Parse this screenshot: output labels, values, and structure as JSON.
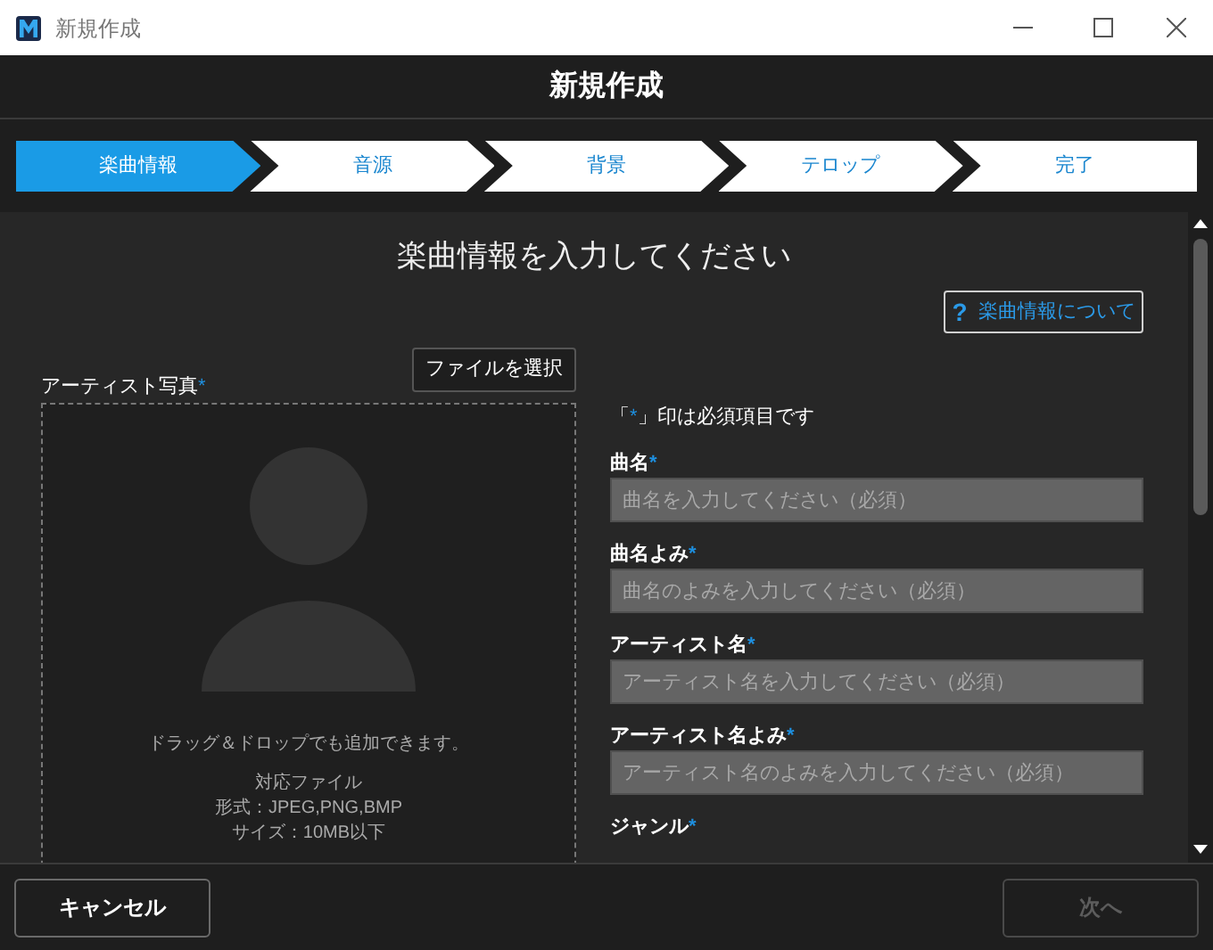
{
  "window": {
    "title": "新規作成"
  },
  "header": {
    "title": "新規作成"
  },
  "steps": [
    {
      "label": "楽曲情報",
      "selected": true
    },
    {
      "label": "音源",
      "selected": false
    },
    {
      "label": "背景",
      "selected": false
    },
    {
      "label": "テロップ",
      "selected": false
    },
    {
      "label": "完了",
      "selected": false
    }
  ],
  "heading": "楽曲情報を入力してください",
  "help_button": {
    "icon": "?",
    "label": "楽曲情報について"
  },
  "photo": {
    "choose_button": "ファイルを選択",
    "label": "アーティスト写真",
    "mark": "*",
    "hint": "ドラッグ＆ドロップでも追加できます。",
    "formats": [
      "対応ファイル",
      "形式：JPEG,PNG,BMP",
      "サイズ：10MB以下"
    ]
  },
  "required_note": {
    "before": "「",
    "mark": "*",
    "after": "」印は必須項目です"
  },
  "fields": [
    {
      "label": "曲名",
      "mark": "*",
      "placeholder": "曲名を入力してください（必須）"
    },
    {
      "label": "曲名よみ",
      "mark": "*",
      "placeholder": "曲名のよみを入力してください（必須）"
    },
    {
      "label": "アーティスト名",
      "mark": "*",
      "placeholder": "アーティスト名を入力してください（必須）"
    },
    {
      "label": "アーティスト名よみ",
      "mark": "*",
      "placeholder": "アーティスト名のよみを入力してください（必須）"
    },
    {
      "label": "ジャンル",
      "mark": "*"
    }
  ],
  "footer": {
    "cancel": {
      "label": "キャンセル",
      "disabled": false
    },
    "next": {
      "label": "次へ",
      "disabled": true
    }
  }
}
